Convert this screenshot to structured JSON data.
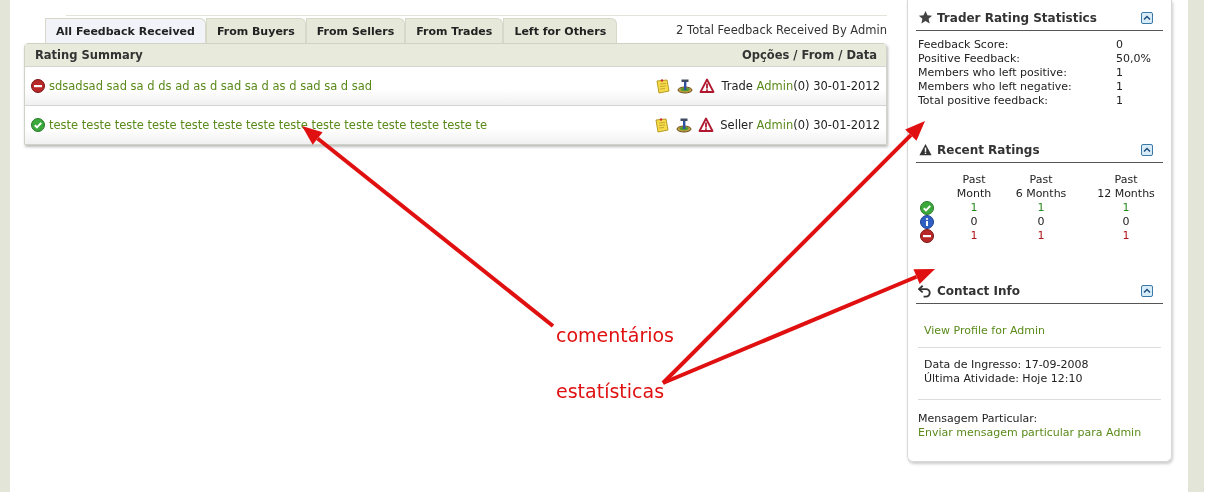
{
  "tabs": [
    {
      "label": "All Feedback Received",
      "selected": true
    },
    {
      "label": "From Buyers",
      "selected": false
    },
    {
      "label": "From Sellers",
      "selected": false
    },
    {
      "label": "From Trades",
      "selected": false
    },
    {
      "label": "Left for Others",
      "selected": false
    }
  ],
  "summary_caption": "2 Total Feedback Received By Admin",
  "table": {
    "columns": [
      "Rating Summary",
      "Opções / From / Data"
    ],
    "rows": [
      {
        "kind": "negative",
        "comment": "sdsadsad sad sa d ds ad as d sad sa d as d sad sa d sad",
        "role": "Trade",
        "user": "Admin",
        "count": "(0)",
        "date": "30-01-2012"
      },
      {
        "kind": "positive",
        "comment": "teste teste teste teste teste teste teste teste teste teste teste teste teste te",
        "role": "Seller",
        "user": "Admin",
        "count": "(0)",
        "date": "30-01-2012"
      }
    ]
  },
  "sidebar": {
    "stats": {
      "title": "Trader Rating Statistics",
      "rows": [
        {
          "label": "Feedback Score:",
          "value": "0"
        },
        {
          "label": "Positive Feedback:",
          "value": "50,0%"
        },
        {
          "label": "Members who left positive:",
          "value": "1"
        },
        {
          "label": "Members who left negative:",
          "value": "1"
        },
        {
          "label": "Total positive feedback:",
          "value": "1"
        }
      ]
    },
    "recent": {
      "title": "Recent Ratings",
      "columns": [
        [
          "Past",
          "Month"
        ],
        [
          "Past",
          "6 Months"
        ],
        [
          "Past",
          "12 Months"
        ]
      ],
      "rows": [
        {
          "kind": "positive",
          "values": [
            "1",
            "1",
            "1"
          ]
        },
        {
          "kind": "neutral",
          "values": [
            "0",
            "0",
            "0"
          ]
        },
        {
          "kind": "negative",
          "values": [
            "1",
            "1",
            "1"
          ]
        }
      ]
    },
    "contact": {
      "title": "Contact Info",
      "profile_link": "View Profile for Admin",
      "joined": "Data de Ingresso: 17-09-2008",
      "last_activity": "Última Atividade: Hoje 12:10",
      "pm_label": "Mensagem Particular:",
      "pm_link": "Enviar mensagem particular para Admin"
    }
  },
  "annotations": [
    {
      "text": "comentários"
    },
    {
      "text": "estatísticas"
    }
  ]
}
